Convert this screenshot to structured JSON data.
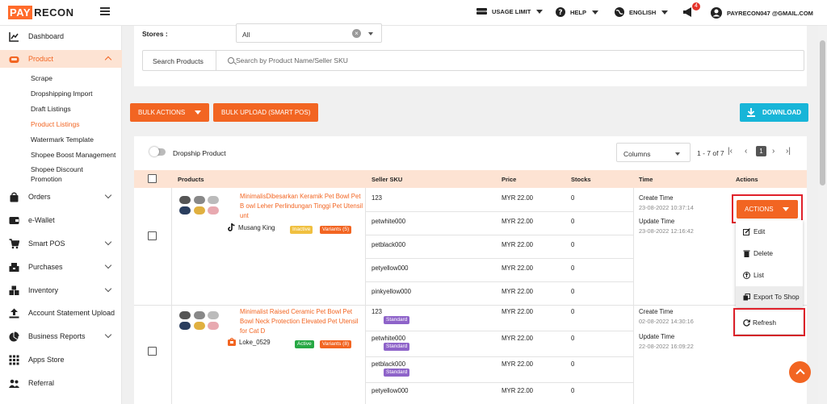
{
  "logo": {
    "part1": "PAY",
    "part2": "RECON"
  },
  "topnav": {
    "usage_limit": "USAGE LIMIT",
    "help": "HELP",
    "language": "ENGLISH",
    "notification_count": "4",
    "user_email": "PAYRECON047 @GMAIL.COM"
  },
  "sidebar": {
    "items": [
      {
        "label": "Dashboard",
        "icon": "chart-line-icon"
      },
      {
        "label": "Product",
        "icon": "product-box-icon"
      },
      {
        "label": "Orders",
        "icon": "orders-bag-icon"
      },
      {
        "label": "e-Wallet",
        "icon": "wallet-icon"
      },
      {
        "label": "Smart POS",
        "icon": "cart-icon"
      },
      {
        "label": "Purchases",
        "icon": "purchases-icon"
      },
      {
        "label": "Inventory",
        "icon": "inventory-icon"
      },
      {
        "label": "Account Statement Upload",
        "icon": "upload-icon"
      },
      {
        "label": "Business Reports",
        "icon": "pie-chart-icon"
      },
      {
        "label": "Apps Store",
        "icon": "grid-icon"
      },
      {
        "label": "Referral",
        "icon": "users-icon"
      }
    ],
    "product_sub": [
      "Scrape",
      "Dropshipping Import",
      "Draft Listings",
      "Product Listings",
      "Watermark Template",
      "Shopee Boost Management",
      "Shopee Discount",
      "Promotion"
    ]
  },
  "filters": {
    "stores_label": "Stores :",
    "stores_value": "All",
    "search_label": "Search Products",
    "search_placeholder": "Search by Product Name/Seller SKU"
  },
  "toolbar": {
    "bulk_actions": "BULK ACTIONS",
    "bulk_upload": "BULK UPLOAD (SMART POS)",
    "download": "DOWNLOAD"
  },
  "table_controls": {
    "dropship_label": "Dropship Product",
    "columns_label": "Columns",
    "pagination": "1 - 7 of 7",
    "current_page": "1"
  },
  "columns": [
    "Products",
    "Seller SKU",
    "Price",
    "Stocks",
    "Time",
    "Actions"
  ],
  "products": [
    {
      "name": "MinimalisDibesarkan Keramik Pet Bowl Pet B owl Leher Perlindungan Tinggi Pet Utensil unt",
      "store": "Musang King",
      "status": "Inactive",
      "variants": "Variants (5)",
      "create_label": "Create Time",
      "create_time": "23-08-2022 10:37:14",
      "update_label": "Update Time",
      "update_time": "23-08-2022 12:16:42",
      "skus": [
        {
          "sku": "123",
          "price": "MYR 22.00",
          "stock": "0"
        },
        {
          "sku": "petwhite000",
          "price": "MYR 22.00",
          "stock": "0"
        },
        {
          "sku": "petblack000",
          "price": "MYR 22.00",
          "stock": "0"
        },
        {
          "sku": "petyellow000",
          "price": "MYR 22.00",
          "stock": "0"
        },
        {
          "sku": "pinkyellow000",
          "price": "MYR 22.00",
          "stock": "0"
        }
      ]
    },
    {
      "name": "Minimalist Raised Ceramic Pet Bowl Pet Bowl Neck Protection Elevated Pet Utensil for Cat D",
      "store": "Loke_0529",
      "status": "Active",
      "variants": "Variants (8)",
      "create_label": "Create Time",
      "create_time": "02-08-2022 14:30:16",
      "update_label": "Update Time",
      "update_time": "22-08-2022 16:09:22",
      "skus": [
        {
          "sku": "123",
          "price": "MYR 22.00",
          "stock": "0",
          "tag": "Standard"
        },
        {
          "sku": "petwhite000",
          "price": "MYR 22.00",
          "stock": "0",
          "tag": "Standard"
        },
        {
          "sku": "petblack000",
          "price": "MYR 22.00",
          "stock": "0",
          "tag": "Standard"
        },
        {
          "sku": "petyellow000",
          "price": "MYR 22.00",
          "stock": "0"
        }
      ]
    }
  ],
  "actions": {
    "button": "ACTIONS",
    "menu": [
      "Edit",
      "Delete",
      "List",
      "Export To Shop",
      "Refresh"
    ]
  },
  "colors": {
    "accent": "#f26522",
    "download": "#17b5d8",
    "highlight": "#e0202a"
  }
}
